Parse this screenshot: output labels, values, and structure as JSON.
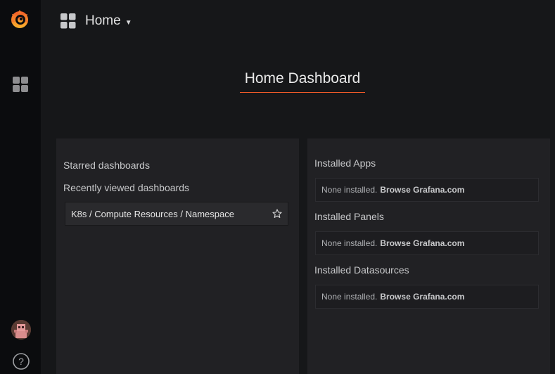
{
  "header": {
    "title": "Home"
  },
  "page": {
    "title": "Home Dashboard"
  },
  "starred": {
    "label": "Starred dashboards"
  },
  "recent": {
    "label": "Recently viewed dashboards",
    "items": [
      {
        "title": "K8s / Compute Resources / Namespace"
      }
    ]
  },
  "apps": {
    "label": "Installed Apps",
    "empty_text": "None installed.",
    "link_text": "Browse Grafana.com"
  },
  "panels": {
    "label": "Installed Panels",
    "empty_text": "None installed.",
    "link_text": "Browse Grafana.com"
  },
  "datasources": {
    "label": "Installed Datasources",
    "empty_text": "None installed.",
    "link_text": "Browse Grafana.com"
  },
  "colors": {
    "brand": "#f05a28",
    "background": "#161719",
    "panel": "#212124",
    "sidebar": "#0b0c0e"
  },
  "icons": {
    "logo": "grafana-logo-icon",
    "dashboards": "dashboards-grid-icon",
    "help": "help-question-icon",
    "star": "star-outline-icon"
  }
}
